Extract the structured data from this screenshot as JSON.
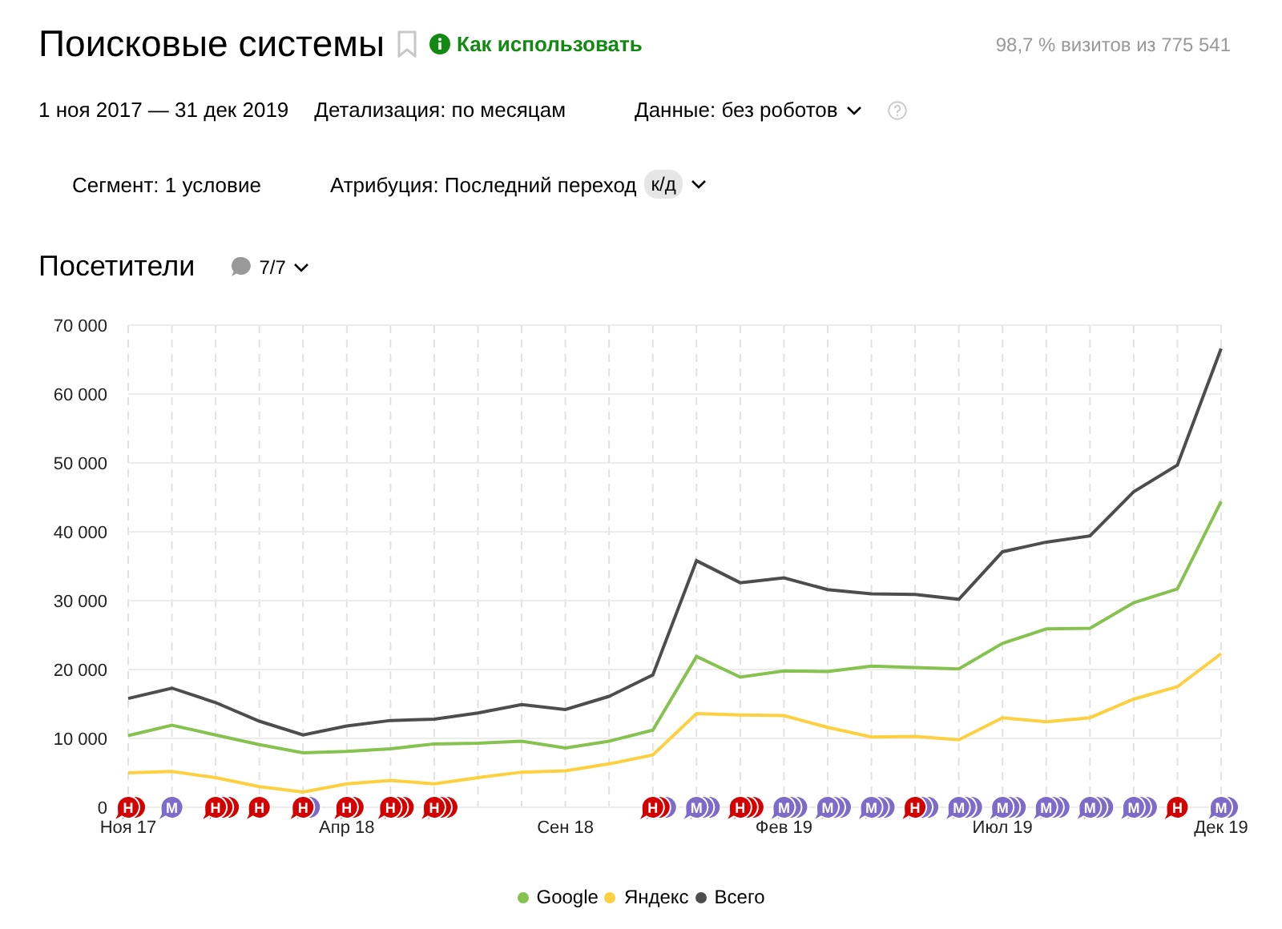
{
  "header": {
    "title": "Поисковые системы",
    "help_link": "Как использовать",
    "stats": "98,7 % визитов из 775 541"
  },
  "filters": {
    "period": "1 ноя 2017 — 31 дек 2019",
    "detail": "Детализация: по месяцам",
    "data": "Данные: без роботов"
  },
  "segment": {
    "segment": "Сегмент: 1 условие",
    "attribution": "Атрибуция: Последний переход",
    "attribution_badge": "к/д"
  },
  "chart_header": {
    "title": "Посетители",
    "notes_count": "7/7"
  },
  "chart_data": {
    "type": "line",
    "categories": [
      "Ноя 17",
      null,
      null,
      null,
      null,
      "Апр 18",
      null,
      null,
      null,
      null,
      "Сен 18",
      null,
      null,
      null,
      null,
      "Фев 19",
      null,
      null,
      null,
      null,
      "Июл 19",
      null,
      null,
      null,
      null,
      "Дек 19"
    ],
    "ylim": [
      0,
      70000
    ],
    "grid": true,
    "yticks": [
      {
        "value": 0,
        "label": "0"
      },
      {
        "value": 10000,
        "label": "10 000"
      },
      {
        "value": 20000,
        "label": "20 000"
      },
      {
        "value": 30000,
        "label": "30 000"
      },
      {
        "value": 40000,
        "label": "40 000"
      },
      {
        "value": 50000,
        "label": "50 000"
      },
      {
        "value": 60000,
        "label": "60 000"
      },
      {
        "value": 70000,
        "label": "70 000"
      }
    ],
    "series": [
      {
        "name": "Google",
        "color": "#86c24f",
        "values": [
          10400,
          11900,
          10500,
          9100,
          7900,
          8100,
          8500,
          9200,
          9300,
          9600,
          8600,
          9600,
          11200,
          21900,
          18900,
          19800,
          19700,
          20500,
          20300,
          20100,
          23800,
          25900,
          26000,
          29700,
          31700,
          44400
        ]
      },
      {
        "name": "Яндекс",
        "color": "#fdd040",
        "values": [
          5000,
          5200,
          4300,
          3000,
          2200,
          3400,
          3900,
          3400,
          4300,
          5100,
          5300,
          6300,
          7600,
          13600,
          13400,
          13300,
          11600,
          10200,
          10300,
          9800,
          13000,
          12400,
          13000,
          15700,
          17500,
          22300
        ]
      },
      {
        "name": "Всего",
        "color": "#4d4d4d",
        "values": [
          15800,
          17300,
          15200,
          12500,
          10500,
          11800,
          12600,
          12800,
          13700,
          14900,
          14200,
          16100,
          19200,
          35800,
          32600,
          33300,
          31600,
          31000,
          30900,
          30200,
          37100,
          38500,
          39400,
          45800,
          49700,
          66600
        ]
      }
    ]
  },
  "note_markers_left": [
    {
      "label": "Н",
      "kind": "red",
      "behind": [
        {
          "kind": "red"
        }
      ]
    },
    {
      "label": "М",
      "kind": "purple"
    },
    {
      "label": "Н",
      "kind": "red",
      "behind": [
        {
          "kind": "red"
        },
        {
          "kind": "red"
        }
      ]
    },
    {
      "label": "Н",
      "kind": "red"
    },
    {
      "label": "Н",
      "kind": "red",
      "behind": [
        {
          "kind": "purple"
        }
      ]
    },
    {
      "label": "Н",
      "kind": "red",
      "behind": [
        {
          "kind": "red"
        }
      ]
    },
    {
      "label": "Н",
      "kind": "red",
      "behind": [
        {
          "kind": "red"
        },
        {
          "kind": "red"
        }
      ]
    },
    {
      "label": "Н",
      "kind": "red",
      "behind": [
        {
          "kind": "red"
        },
        {
          "kind": "red"
        }
      ]
    }
  ],
  "note_markers_right": [
    {
      "label": "Н",
      "kind": "red",
      "behind": [
        {
          "kind": "red"
        },
        {
          "kind": "purple"
        }
      ]
    },
    {
      "label": "М",
      "kind": "purple",
      "behind": [
        {
          "kind": "purple"
        },
        {
          "kind": "purple"
        }
      ]
    },
    {
      "label": "Н",
      "kind": "red",
      "behind": [
        {
          "kind": "red"
        },
        {
          "kind": "red"
        }
      ]
    },
    {
      "label": "М",
      "kind": "purple",
      "behind": [
        {
          "kind": "purple"
        },
        {
          "kind": "purple"
        }
      ]
    },
    {
      "label": "М",
      "kind": "purple",
      "behind": [
        {
          "kind": "purple"
        },
        {
          "kind": "purple"
        }
      ]
    },
    {
      "label": "М",
      "kind": "purple",
      "behind": [
        {
          "kind": "purple"
        },
        {
          "kind": "purple"
        }
      ]
    },
    {
      "label": "Н",
      "kind": "red",
      "behind": [
        {
          "kind": "purple"
        },
        {
          "kind": "purple"
        }
      ]
    },
    {
      "label": "М",
      "kind": "purple",
      "behind": [
        {
          "kind": "purple"
        },
        {
          "kind": "purple"
        }
      ]
    },
    {
      "label": "М",
      "kind": "purple",
      "behind": [
        {
          "kind": "purple"
        },
        {
          "kind": "purple"
        }
      ]
    },
    {
      "label": "М",
      "kind": "purple",
      "behind": [
        {
          "kind": "purple"
        },
        {
          "kind": "purple"
        }
      ]
    },
    {
      "label": "М",
      "kind": "purple",
      "behind": [
        {
          "kind": "purple"
        },
        {
          "kind": "purple"
        }
      ]
    },
    {
      "label": "М",
      "kind": "purple",
      "behind": [
        {
          "kind": "purple"
        },
        {
          "kind": "purple"
        }
      ]
    },
    {
      "label": "Н",
      "kind": "red"
    },
    {
      "label": "М",
      "kind": "purple",
      "behind": [
        {
          "kind": "purple"
        }
      ]
    }
  ]
}
